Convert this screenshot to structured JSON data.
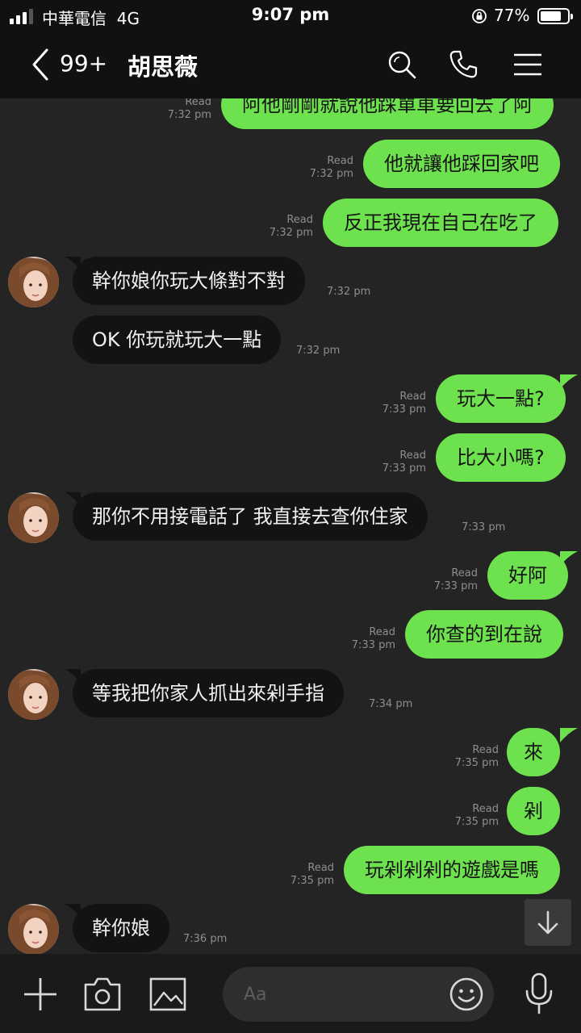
{
  "status_bar": {
    "carrier": "中華電信",
    "network": "4G",
    "time": "9:07 pm",
    "battery": "77%",
    "battery_level": 0.77,
    "signal_bars": 3
  },
  "header": {
    "back_icon": "chevron-left-icon",
    "unread_count": "99+",
    "contact_name": "胡思薇",
    "icons": [
      "search-icon",
      "phone-icon",
      "menu-icon"
    ]
  },
  "messages": [
    {
      "dir": "out",
      "text": "阿他剛剛就說他踩單車要回去了阿",
      "read": "Read",
      "time": "7:32 pm"
    },
    {
      "dir": "out",
      "text": "他就讓他踩回家吧",
      "read": "Read",
      "time": "7:32 pm"
    },
    {
      "dir": "out",
      "text": "反正我現在自己在吃了",
      "read": "Read",
      "time": "7:32 pm"
    },
    {
      "dir": "in",
      "text": "幹你娘你玩大條對不對",
      "time": "7:32 pm"
    },
    {
      "dir": "in",
      "text": "OK 你玩就玩大一點",
      "time": "7:32 pm"
    },
    {
      "dir": "out",
      "text": "玩大一點?",
      "read": "Read",
      "time": "7:33 pm"
    },
    {
      "dir": "out",
      "text": "比大小嗎?",
      "read": "Read",
      "time": "7:33 pm"
    },
    {
      "dir": "in",
      "text": "那你不用接電話了 我直接去查你住家",
      "time": "7:33 pm"
    },
    {
      "dir": "out",
      "text": "好阿",
      "read": "Read",
      "time": "7:33 pm"
    },
    {
      "dir": "out",
      "text": "你查的到在說",
      "read": "Read",
      "time": "7:33 pm"
    },
    {
      "dir": "in",
      "text": "等我把你家人抓出來剁手指",
      "time": "7:34 pm"
    },
    {
      "dir": "out",
      "text": "來",
      "read": "Read",
      "time": "7:35 pm"
    },
    {
      "dir": "out",
      "text": "剁",
      "read": "Read",
      "time": "7:35 pm"
    },
    {
      "dir": "out",
      "text": "玩剁剁剁的遊戲是嗎",
      "read": "Read",
      "time": "7:35 pm"
    },
    {
      "dir": "in",
      "text": "幹你娘",
      "time": "7:36 pm"
    }
  ],
  "scroll_down_icon": "arrow-down-icon",
  "bottom_bar": {
    "icons": [
      "plus-icon",
      "camera-icon",
      "image-icon",
      "emoji-icon",
      "microphone-icon"
    ],
    "input_placeholder": "Aa"
  },
  "colors": {
    "outgoing_bubble": "#6ee14e",
    "incoming_bubble": "#131313",
    "background": "#242424",
    "bar": "#111111"
  }
}
